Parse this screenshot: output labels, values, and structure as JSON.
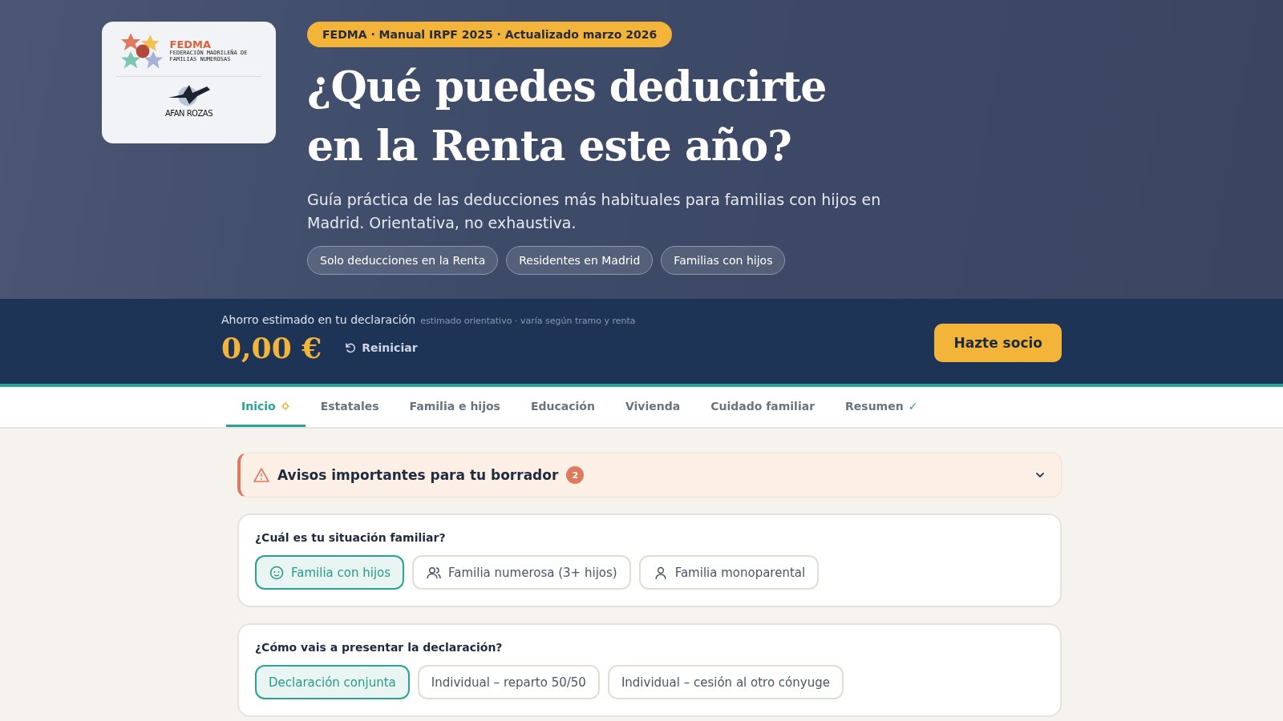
{
  "hero": {
    "logo": {
      "name": "FEDMA",
      "subtitle": "FEDERACIÓN MADRILEÑA DE FAMILIAS NUMEROSAS",
      "partner": "AFAN ROZAS"
    },
    "badge": "FEDMA · Manual IRPF 2025 · Actualizado marzo 2026",
    "title_lines": [
      "¿Qué puedes deducirte",
      "en la Renta este año?"
    ],
    "subtitle": "Guía práctica de las deducciones más habituales para familias con hijos en Madrid. Orientativa, no exhaustiva.",
    "chips": [
      "Solo deducciones en la Renta",
      "Residentes en Madrid",
      "Familias con hijos"
    ]
  },
  "savings": {
    "label": "Ahorro estimado en tu declaración",
    "note": "estimado orientativo · varía según tramo y renta",
    "amount": "0,00 €",
    "reset": "Reiniciar",
    "cta": "Hazte socio"
  },
  "tabs": [
    {
      "label": "Inicio",
      "selected": true,
      "kind": "dot"
    },
    {
      "label": "Estatales",
      "selected": false,
      "kind": "plain"
    },
    {
      "label": "Familia e hijos",
      "selected": false,
      "kind": "plain"
    },
    {
      "label": "Educación",
      "selected": false,
      "kind": "plain"
    },
    {
      "label": "Vivienda",
      "selected": false,
      "kind": "plain"
    },
    {
      "label": "Cuidado familiar",
      "selected": false,
      "kind": "plain"
    },
    {
      "label": "Resumen",
      "selected": false,
      "kind": "check",
      "mark": "✓"
    }
  ],
  "alert": {
    "title": "Avisos importantes para tu borrador",
    "count": "2",
    "expanded": false
  },
  "questions": [
    {
      "title": "¿Cuál es tu situación familiar?",
      "options": [
        {
          "label": "Familia con hijos",
          "selected": true,
          "kind": "baby"
        },
        {
          "label": "Familia numerosa (3+ hijos)",
          "selected": false,
          "kind": "users"
        },
        {
          "label": "Familia monoparental",
          "selected": false,
          "kind": "user"
        }
      ]
    },
    {
      "title": "¿Cómo vais a presentar la declaración?",
      "options": [
        {
          "label": "Declaración conjunta",
          "selected": true,
          "kind": "none"
        },
        {
          "label": "Individual – reparto 50/50",
          "selected": false,
          "kind": "none"
        },
        {
          "label": "Individual – cesión al otro cónyuge",
          "selected": false,
          "kind": "none"
        }
      ]
    }
  ]
}
